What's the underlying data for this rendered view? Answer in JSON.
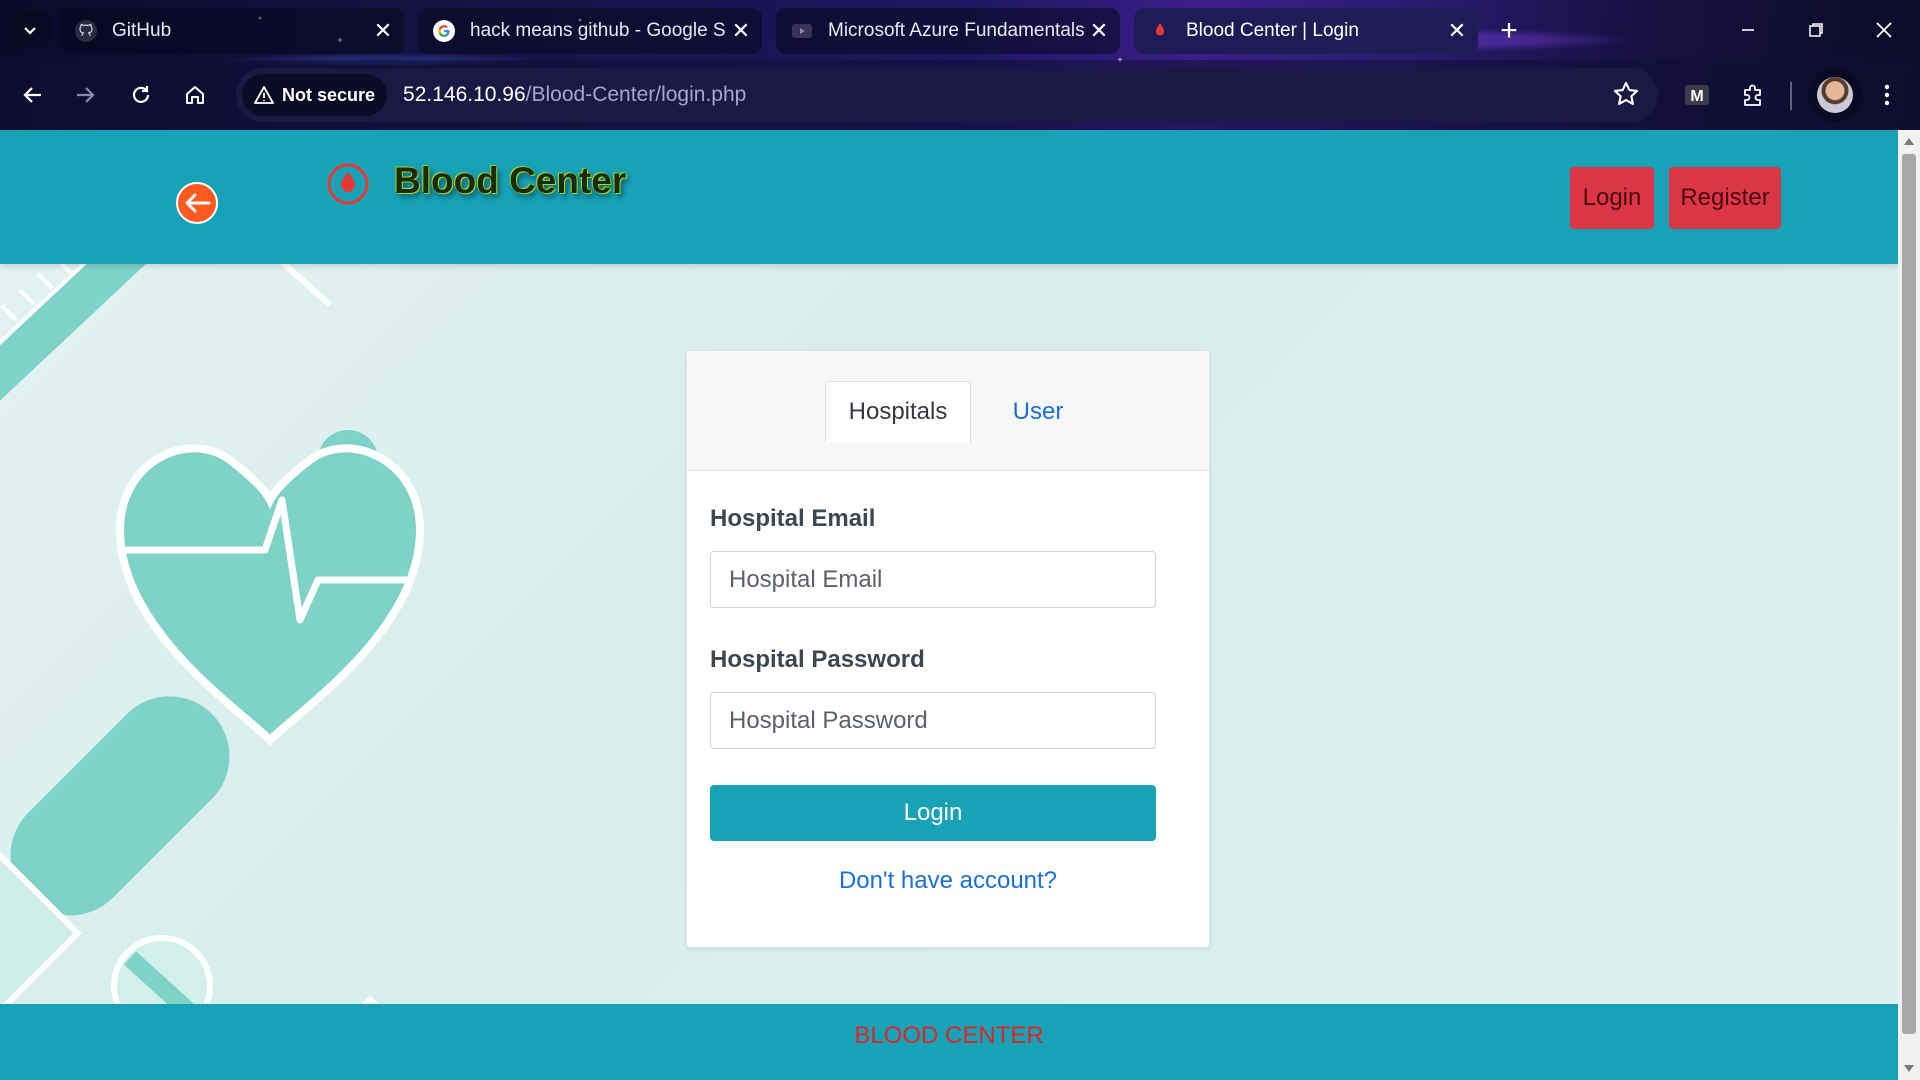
{
  "browser": {
    "tabs": [
      {
        "title": "GitHub",
        "active": false
      },
      {
        "title": "hack means github - Google S",
        "active": false
      },
      {
        "title": "Microsoft Azure Fundamentals",
        "active": false
      },
      {
        "title": "Blood Center | Login",
        "active": true
      }
    ],
    "security_label": "Not secure",
    "url_host": "52.146.10.96",
    "url_path": "/Blood-Center/login.php",
    "extension_letter": "M"
  },
  "header": {
    "brand": "Blood Center",
    "login_label": "Login",
    "register_label": "Register"
  },
  "login_card": {
    "tabs": {
      "hospitals": "Hospitals",
      "user": "User"
    },
    "email_label": "Hospital Email",
    "email_placeholder": "Hospital Email",
    "password_label": "Hospital Password",
    "password_placeholder": "Hospital Password",
    "submit_label": "Login",
    "signup_link": "Don't have account?"
  },
  "footer": {
    "text": "BLOOD CENTER"
  },
  "colors": {
    "primary": "#17a2b8",
    "danger": "#dc3545",
    "link": "#1a6fd8"
  }
}
